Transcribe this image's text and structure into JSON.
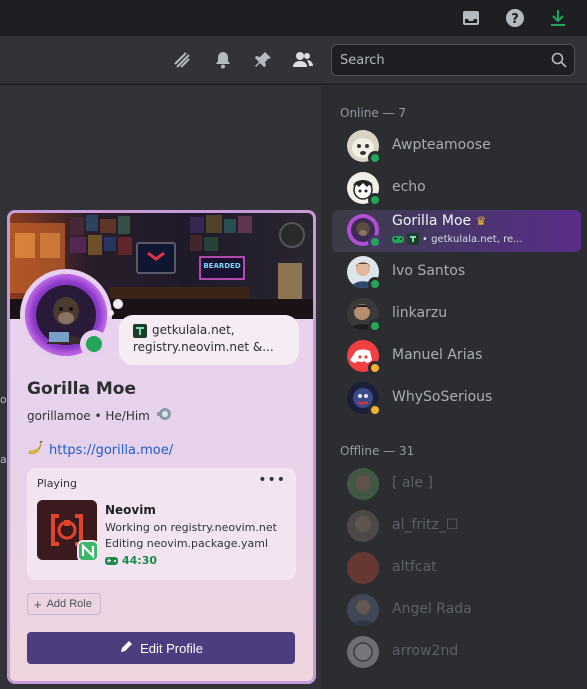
{
  "titlebar": {
    "icons": [
      "inbox-icon",
      "help-icon",
      "download-icon"
    ]
  },
  "header": {
    "icons": [
      "threads-icon",
      "bell-icon",
      "pin-icon",
      "members-icon"
    ],
    "search_placeholder": "Search"
  },
  "main": {
    "edge_text_1": "ol",
    "edge_text_2": "ai"
  },
  "members": {
    "online_title": "Online — 7",
    "offline_title": "Offline — 31",
    "online": [
      {
        "name": "Awpteamoose",
        "status": "online"
      },
      {
        "name": "echo",
        "status": "online"
      },
      {
        "name": "Gorilla Moe",
        "status": "online",
        "activity": "• getkulala.net, re..."
      },
      {
        "name": "Ivo Santos",
        "status": "online"
      },
      {
        "name": "linkarzu",
        "status": "online"
      },
      {
        "name": "Manuel Arias",
        "status": "idle"
      },
      {
        "name": "WhySoSerious",
        "status": "idle"
      }
    ],
    "offline": [
      {
        "name": "[ ale ]"
      },
      {
        "name": "al_fritz_☐"
      },
      {
        "name": "altfcat"
      },
      {
        "name": "Angel Rada"
      },
      {
        "name": "arrow2nd"
      }
    ]
  },
  "profile": {
    "bubble_line1": "getkulala.net,",
    "bubble_line2": "registry.neovim.net &...",
    "display_name": "Gorilla Moe",
    "username_pronouns": "gorillamoe • He/Him",
    "link": "https://gorilla.moe/",
    "activity": {
      "heading": "Playing",
      "more": "•••",
      "title": "Neovim",
      "detail1": "Working on registry.neovim.net",
      "detail2": "Editing neovim.package.yaml",
      "elapsed": "44:30"
    },
    "add_role_label": "Add Role",
    "edit_profile_label": "Edit Profile"
  },
  "colors": {
    "online": "#23a55a",
    "idle": "#f0b232",
    "brand": "#5865f2",
    "edit_button": "#4e3d7e"
  }
}
